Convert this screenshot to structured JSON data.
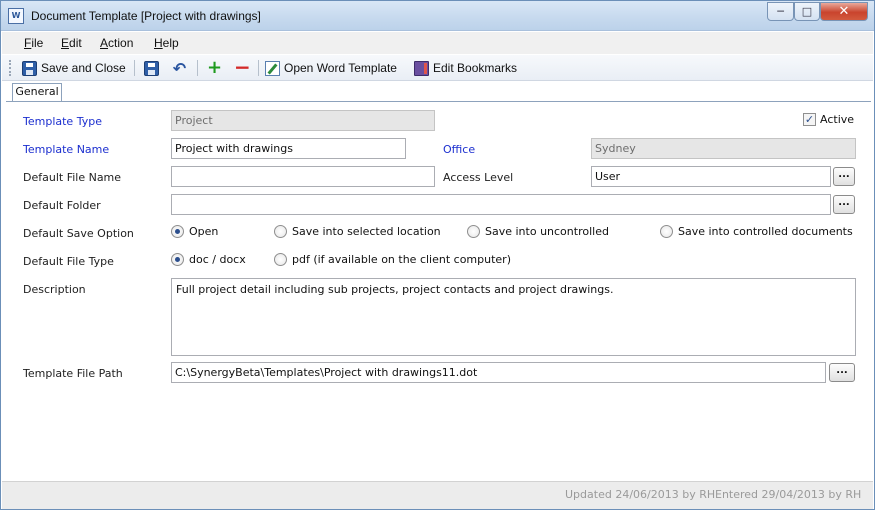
{
  "window": {
    "title": "Document Template [Project with drawings]",
    "icon": "word-document-icon",
    "controls": {
      "minimize": "─",
      "maximize": "□",
      "close": "✕"
    }
  },
  "menu": [
    "File",
    "Edit",
    "Action",
    "Help"
  ],
  "toolbar": {
    "save_close": "Save and Close",
    "open_word": "Open Word Template",
    "edit_bookmarks": "Edit Bookmarks",
    "icons": {
      "save_close": "save-icon",
      "save": "save-icon",
      "undo": "undo-icon",
      "add": "plus-icon",
      "remove": "minus-icon",
      "open_word": "word-template-icon",
      "edit_bookmarks": "bookmarks-icon"
    },
    "glyphs": {
      "undo": "↶",
      "add": "+",
      "remove": "−"
    }
  },
  "tabs": [
    "General"
  ],
  "form": {
    "template_type": {
      "label": "Template Type",
      "value": "Project"
    },
    "active": {
      "label": "Active",
      "checked": true,
      "mark": "✓"
    },
    "template_name": {
      "label": "Template Name",
      "value": "Project with drawings"
    },
    "office": {
      "label": "Office",
      "value": "Sydney"
    },
    "default_file_name": {
      "label": "Default File Name",
      "value": ""
    },
    "access_level": {
      "label": "Access Level",
      "value": "User",
      "button": "..."
    },
    "default_folder": {
      "label": "Default Folder",
      "value": "",
      "button": "..."
    },
    "save_option": {
      "label": "Default Save Option",
      "options": [
        "Open",
        "Save into selected location",
        "Save into uncontrolled",
        "Save into controlled documents"
      ],
      "selected": "Open"
    },
    "file_type": {
      "label": "Default File Type",
      "options": [
        "doc / docx",
        "pdf (if available on the client computer)"
      ],
      "selected": "doc / docx"
    },
    "description": {
      "label": "Description",
      "value": "Full project detail including sub projects, project contacts and project drawings."
    },
    "file_path": {
      "label": "Template File Path",
      "value": "C:\\SynergyBeta\\Templates\\Project with drawings11.dot",
      "button": "..."
    }
  },
  "status": {
    "updated": "Updated 24/06/2013 by RH",
    "entered": "Entered 29/04/2013 by RH"
  },
  "colors": {
    "label_required": "#1c2fcf",
    "titlebar": "#c6d9ee",
    "status_text": "#9a9a9a"
  }
}
